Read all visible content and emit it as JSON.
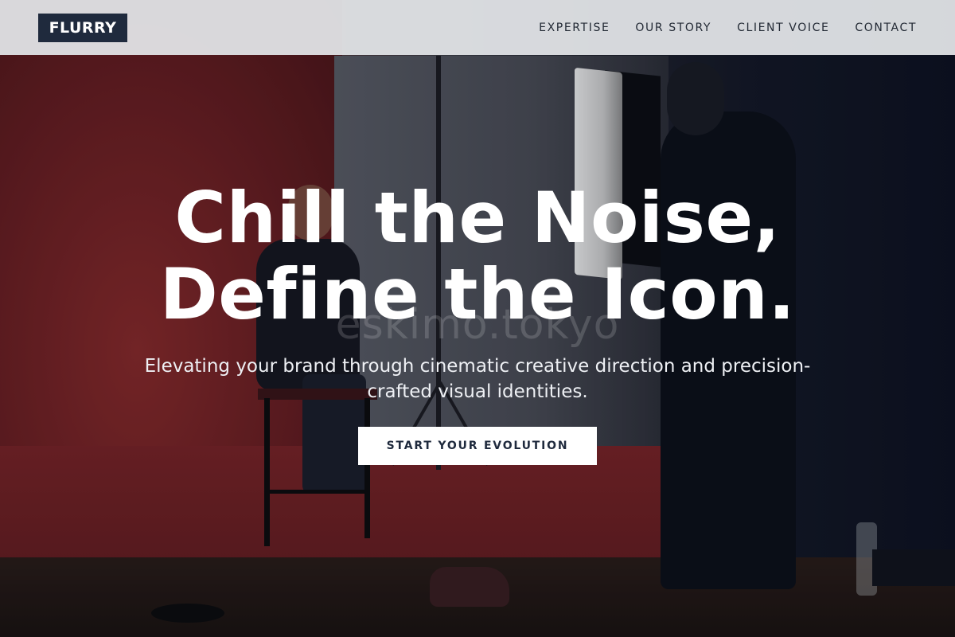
{
  "brand": {
    "logo_text": "FLURRY"
  },
  "nav": {
    "items": [
      {
        "label": "EXPERTISE"
      },
      {
        "label": "OUR STORY"
      },
      {
        "label": "CLIENT VOICE"
      },
      {
        "label": "CONTACT"
      }
    ]
  },
  "hero": {
    "headline_line1": "Chill the Noise,",
    "headline_line2": "Define the Icon.",
    "subtitle": "Elevating your brand through cinematic creative direction and precision-crafted visual identities.",
    "cta_label": "START YOUR EVOLUTION",
    "watermark": "eskimo.tokyo"
  },
  "colors": {
    "header_bg": "#e2e4e8",
    "logo_bg": "#1f2a3d",
    "nav_text": "#232a35",
    "cta_bg": "#ffffff",
    "cta_text": "#1f2a3d",
    "headline": "#ffffff"
  }
}
